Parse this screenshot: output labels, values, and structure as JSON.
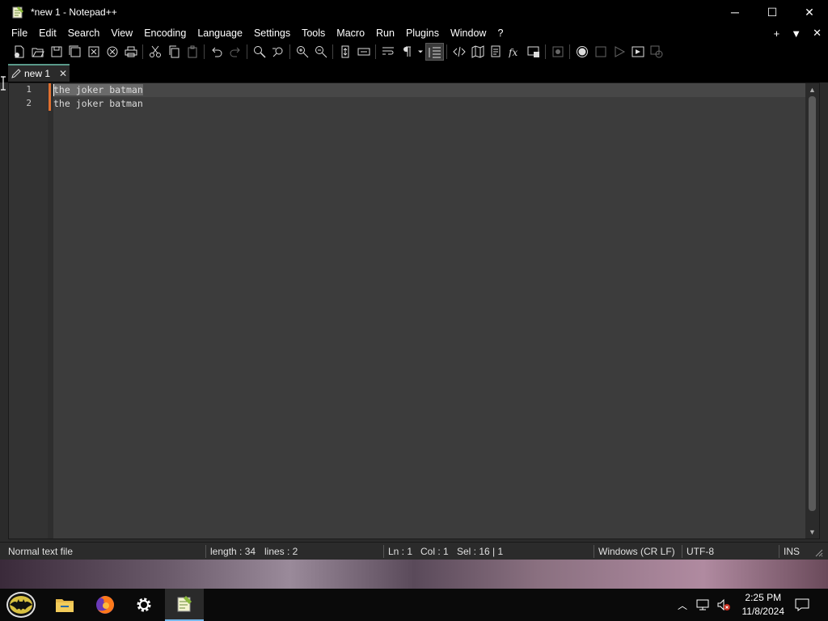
{
  "window": {
    "title": "*new 1 - Notepad++",
    "minimize": "─",
    "maximize": "☐",
    "close": "✕"
  },
  "menu": {
    "items": [
      "File",
      "Edit",
      "Search",
      "View",
      "Encoding",
      "Language",
      "Settings",
      "Tools",
      "Macro",
      "Run",
      "Plugins",
      "Window",
      "?"
    ],
    "right": [
      "+",
      "▼",
      "✕"
    ]
  },
  "tab": {
    "label": "new 1",
    "close": "✕"
  },
  "editor": {
    "line_numbers": [
      "1",
      "2"
    ],
    "lines": [
      "the joker batman",
      "the joker batman"
    ]
  },
  "status": {
    "file_type": "Normal text file",
    "length": "length : 34",
    "lines": "lines : 2",
    "ln": "Ln : 1",
    "col": "Col : 1",
    "sel": "Sel : 16 | 1",
    "eol": "Windows (CR LF)",
    "encoding": "UTF-8",
    "mode": "INS"
  },
  "taskbar": {
    "time": "2:25 PM",
    "date": "11/8/2024"
  },
  "colors": {
    "accent_tab": "#5a9a8a",
    "change_mark": "#e07030",
    "taskbar_active": "#76b9ed"
  }
}
